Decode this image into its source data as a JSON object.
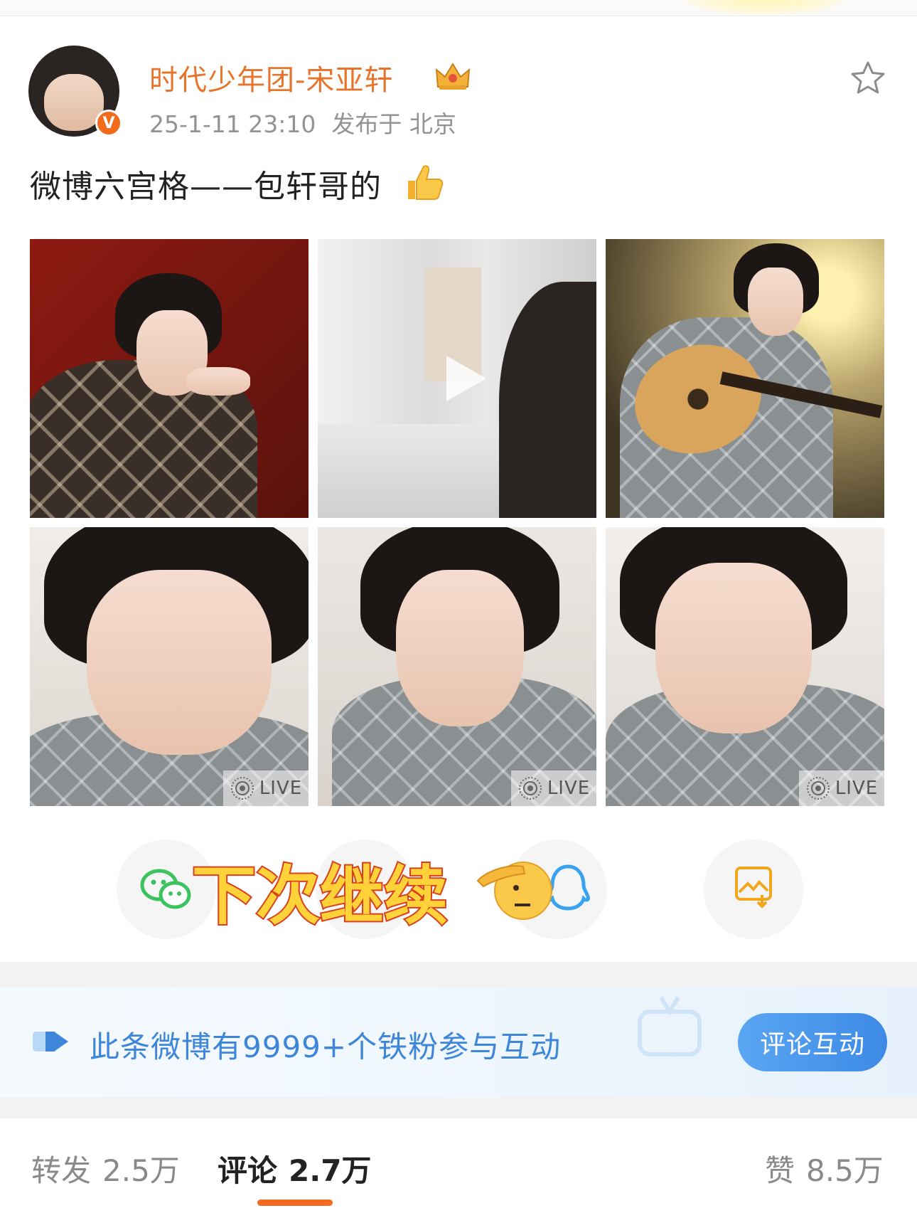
{
  "post": {
    "username": "时代少年团-宋亚轩",
    "timestamp": "25-1-11 23:10",
    "location": "发布于 北京",
    "verified_badge": "V",
    "text": "微博六宫格——包轩哥的",
    "emoji": "thumbs-up-icon"
  },
  "media": {
    "live_label": "LIVE",
    "items": [
      {
        "type": "photo",
        "description_icon": "photo-red-background"
      },
      {
        "type": "video",
        "description_icon": "play-icon"
      },
      {
        "type": "photo",
        "description_icon": "photo-guitar"
      },
      {
        "type": "live_photo"
      },
      {
        "type": "live_photo"
      },
      {
        "type": "live_photo"
      }
    ]
  },
  "share_bar": {
    "icons": [
      "wechat-icon",
      "qq-icon",
      "save-image-icon"
    ],
    "sticker_text": "下次继续"
  },
  "iron_fan": {
    "text": "此条微博有9999+个铁粉参与互动",
    "button": "评论互动"
  },
  "stats": {
    "repost_label": "转发",
    "repost_count": "2.5万",
    "comment_label": "评论",
    "comment_count": "2.7万",
    "like_label": "赞",
    "like_count": "8.5万"
  },
  "colors": {
    "username": "#e8742b",
    "accent_orange": "#f36b22",
    "link_blue": "#3d86d9",
    "button_blue": "#3d8ae6"
  }
}
